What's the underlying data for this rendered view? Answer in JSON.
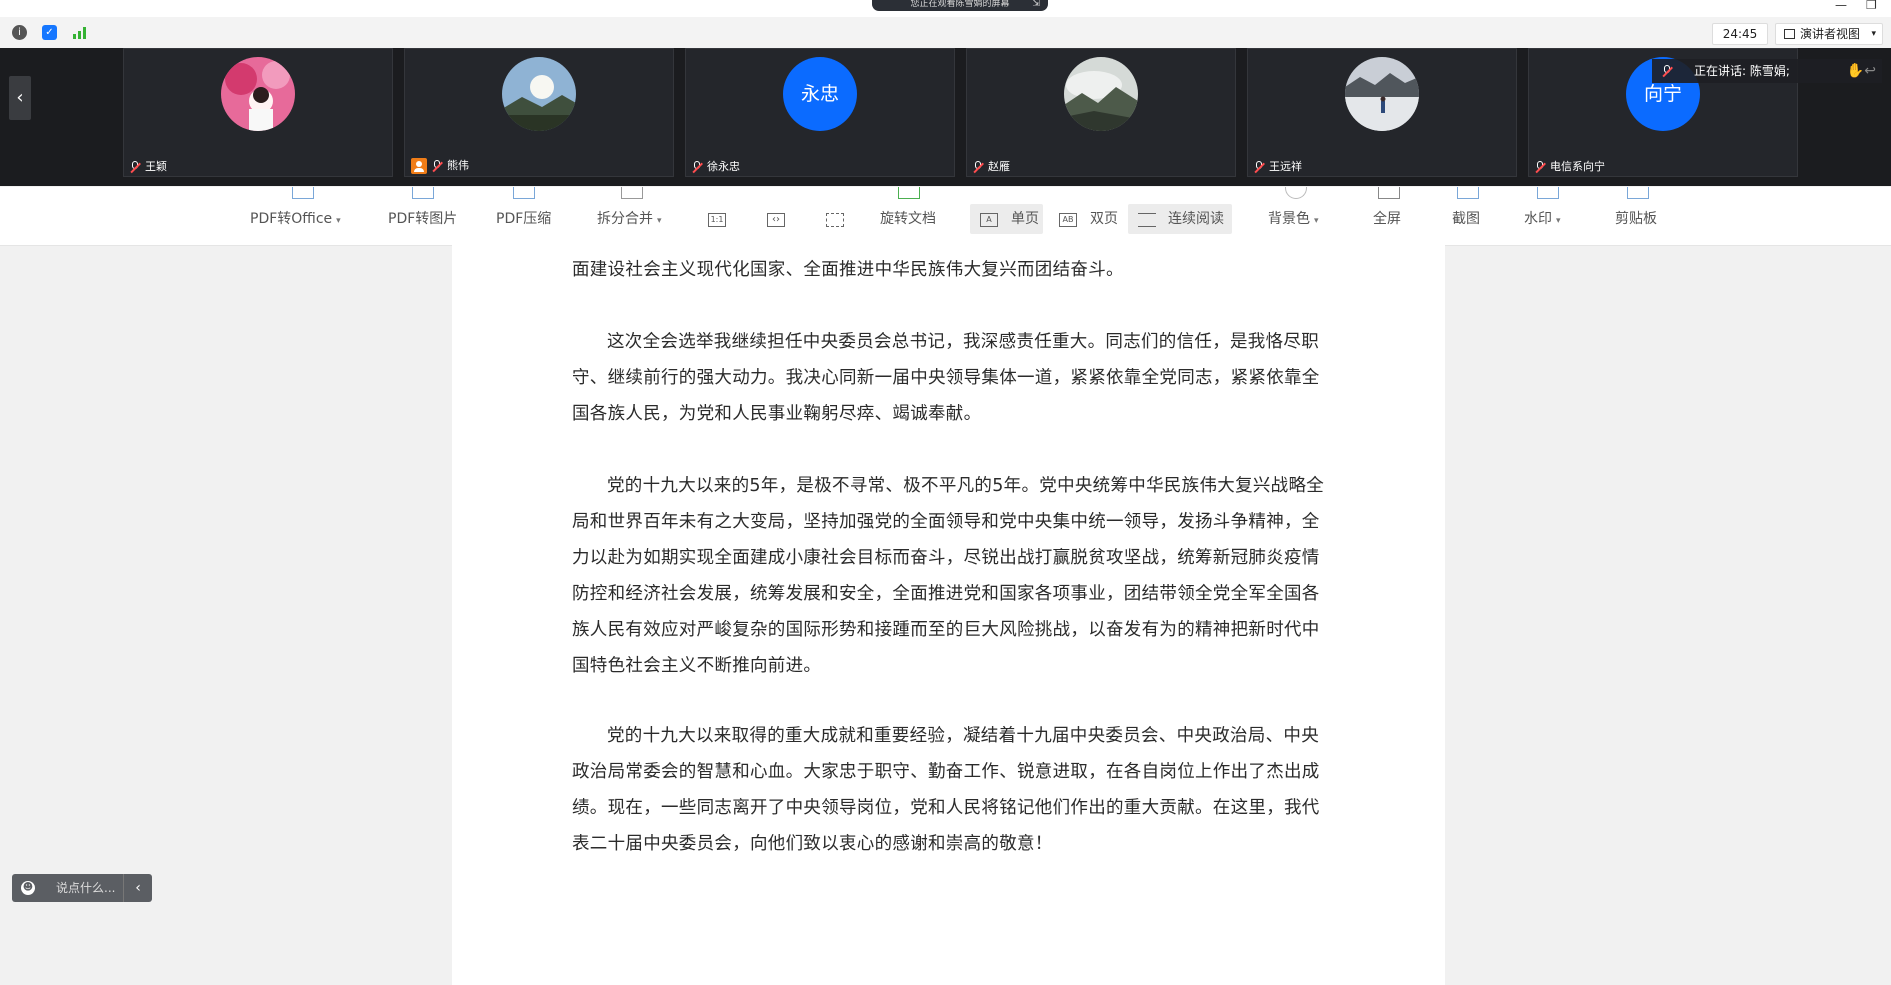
{
  "title_bar": {
    "share_notice": "您正在观看陈雪娟的屏幕",
    "minimize": "—",
    "restore": "❐"
  },
  "status_bar": {
    "timer": "24:45",
    "view_mode": "演讲者视图"
  },
  "participants": [
    {
      "name": "王颖",
      "avatar_type": "photo",
      "avatar_color": "#d5477a"
    },
    {
      "name": "熊伟",
      "avatar_type": "photo",
      "avatar_color": "#6d8aa8"
    },
    {
      "name": "徐永忠",
      "avatar_type": "text",
      "avatar_text": "永忠"
    },
    {
      "name": "赵雁",
      "avatar_type": "photo",
      "avatar_color": "#8f9a8f"
    },
    {
      "name": "王远祥",
      "avatar_type": "photo",
      "avatar_color": "#bfc6cf"
    },
    {
      "name": "电信系向宁",
      "avatar_type": "text",
      "avatar_text": "向宁"
    }
  ],
  "speaking_now": "正在讲话: 陈雪娟;",
  "pdf_toolbar": {
    "pdf_to_office": "PDF转Office",
    "pdf_to_image": "PDF转图片",
    "pdf_compress": "PDF压缩",
    "split_merge": "拆分合并",
    "actual_size": "1:1",
    "rotate_doc": "旋转文档",
    "single_page": "单页",
    "double_page": "双页",
    "continuous": "连续阅读",
    "background": "背景色",
    "fullscreen": "全屏",
    "screenshot": "截图",
    "watermark": "水印",
    "clipboard": "剪贴板"
  },
  "document": {
    "paragraphs": [
      "面建设社会主义现代化国家、全面推进中华民族伟大复兴而团结奋斗。",
      "这次全会选举我继续担任中央委员会总书记，我深感责任重大。同志们的信任，是我恪尽职守、继续前行的强大动力。我决心同新一届中央领导集体一道，紧紧依靠全党同志，紧紧依靠全国各族人民，为党和人民事业鞠躬尽瘁、竭诚奉献。",
      "党的十九大以来的5年，是极不寻常、极不平凡的5年。党中央统筹中华民族伟大复兴战略全局和世界百年未有之大变局，坚持加强党的全面领导和党中央集中统一领导，发扬斗争精神，全力以赴为如期实现全面建成小康社会目标而奋斗，尽锐出战打赢脱贫攻坚战，统筹新冠肺炎疫情防控和经济社会发展，统筹发展和安全，全面推进党和国家各项事业，团结带领全党全军全国各族人民有效应对严峻复杂的国际形势和接踵而至的巨大风险挑战，以奋发有为的精神把新时代中国特色社会主义不断推向前进。",
      "党的十九大以来取得的重大成就和重要经验，凝结着十九届中央委员会、中央政治局、中央政治局常委会的智慧和心血。大家忠于职守、勤奋工作、锐意进取，在各自岗位上作出了杰出成绩。现在，一些同志离开了中央领导岗位，党和人民将铭记他们作出的重大贡献。在这里，我代表二十届中央委员会，向他们致以衷心的感谢和崇高的敬意！"
    ]
  },
  "chat": {
    "placeholder": "说点什么..."
  }
}
